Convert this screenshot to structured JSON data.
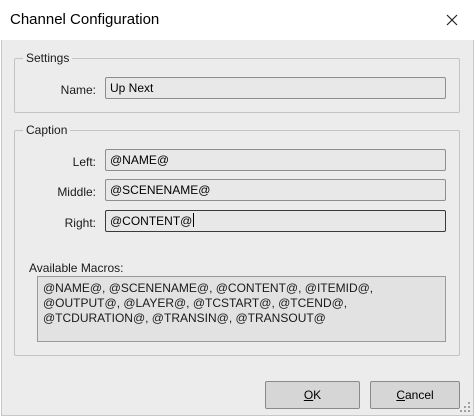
{
  "window": {
    "title": "Channel Configuration",
    "close_glyph": "✕"
  },
  "settings": {
    "legend": "Settings",
    "name_label": "Name:",
    "name_value": "Up Next"
  },
  "caption": {
    "legend": "Caption",
    "left_label": "Left:",
    "left_value": "@NAME@",
    "middle_label": "Middle:",
    "middle_value": "@SCENENAME@",
    "right_label": "Right:",
    "right_value": "@CONTENT@"
  },
  "macros": {
    "label": "Available Macros:",
    "line1": "@NAME@, @SCENENAME@, @CONTENT@, @ITEMID@,",
    "line2": "@OUTPUT@, @LAYER@, @TCSTART@, @TCEND@,",
    "line3": "@TCDURATION@, @TRANSIN@, @TRANSOUT@"
  },
  "buttons": {
    "ok_mnemonic": "O",
    "ok_rest": "K",
    "cancel_mnemonic": "C",
    "cancel_rest": "ancel"
  },
  "colors": {
    "dialog_background": "#ececec",
    "field_background": "#e8e8e8",
    "button_face": "#d6d6d6"
  }
}
